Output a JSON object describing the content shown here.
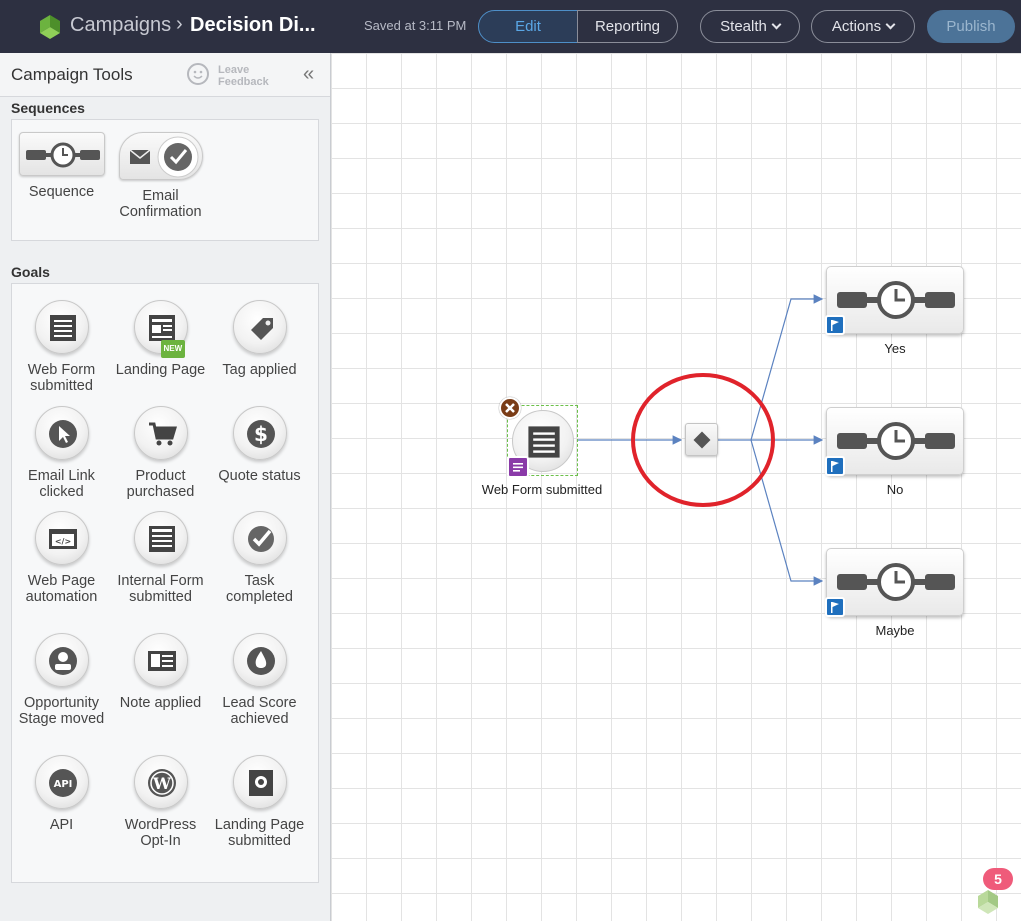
{
  "header": {
    "breadcrumb_root": "Campaigns",
    "breadcrumb_sep": "›",
    "breadcrumb_current": "Decision Di...",
    "saved_status": "Saved at 3:11 PM",
    "tab_edit": "Edit",
    "tab_reporting": "Reporting",
    "stealth_label": "Stealth",
    "actions_label": "Actions",
    "publish_label": "Publish"
  },
  "sidebar": {
    "title": "Campaign Tools",
    "feedback_line1": "Leave",
    "feedback_line2": "Feedback",
    "collapse_glyph": "«",
    "sequences_title": "Sequences",
    "sequences": [
      {
        "label": "Sequence",
        "icon": "sequence-icon"
      },
      {
        "label": "Email Confirmation",
        "icon": "email-confirmation-icon"
      }
    ],
    "goals_title": "Goals",
    "goals": [
      {
        "label": "Web Form submitted",
        "icon": "web-form-icon"
      },
      {
        "label": "Landing Page",
        "icon": "landing-page-icon",
        "badge": "NEW"
      },
      {
        "label": "Tag applied",
        "icon": "tag-icon"
      },
      {
        "label": "Email Link clicked",
        "icon": "cursor-icon"
      },
      {
        "label": "Product purchased",
        "icon": "cart-icon"
      },
      {
        "label": "Quote status",
        "icon": "dollar-icon"
      },
      {
        "label": "Web Page automation",
        "icon": "code-icon"
      },
      {
        "label": "Internal Form submitted",
        "icon": "internal-form-icon"
      },
      {
        "label": "Task completed",
        "icon": "check-icon"
      },
      {
        "label": "Opportunity Stage moved",
        "icon": "person-icon"
      },
      {
        "label": "Note applied",
        "icon": "note-icon"
      },
      {
        "label": "Lead Score achieved",
        "icon": "flame-icon"
      },
      {
        "label": "API",
        "icon": "api-icon"
      },
      {
        "label": "WordPress Opt-In",
        "icon": "wordpress-icon"
      },
      {
        "label": "Landing Page submitted",
        "icon": "landing-submit-icon"
      }
    ]
  },
  "canvas": {
    "source_node_label": "Web Form submitted",
    "branches": [
      {
        "label": "Yes"
      },
      {
        "label": "No"
      },
      {
        "label": "Maybe"
      }
    ],
    "highlight_color": "#e0232b",
    "connector_color": "#5b82c0"
  },
  "footer": {
    "notification_count": "5"
  }
}
